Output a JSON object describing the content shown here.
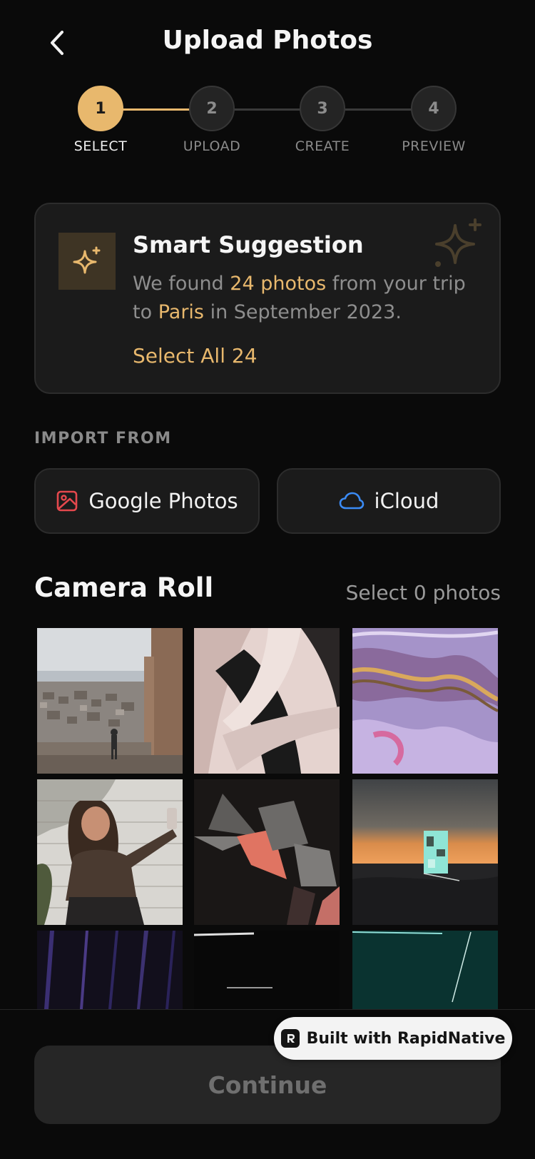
{
  "header": {
    "title": "Upload Photos"
  },
  "stepper": {
    "steps": [
      {
        "number": "1",
        "label": "SELECT"
      },
      {
        "number": "2",
        "label": "UPLOAD"
      },
      {
        "number": "3",
        "label": "CREATE"
      },
      {
        "number": "4",
        "label": "PREVIEW"
      }
    ],
    "current_step": 1
  },
  "suggestion": {
    "title": "Smart Suggestion",
    "text_1": "We found ",
    "photo_count": "24 photos",
    "text_2": " from your trip to ",
    "place": "Paris",
    "text_3": " in September 2023.",
    "select_all": "Select All 24"
  },
  "import": {
    "label": "IMPORT FROM",
    "google": "Google Photos",
    "icloud": "iCloud"
  },
  "camera_roll": {
    "title": "Camera Roll",
    "select_label": "Select 0 photos"
  },
  "footer": {
    "continue": "Continue",
    "badge": "Built with RapidNative"
  },
  "colors": {
    "accent": "#e8b86d",
    "background": "#0a0a0a",
    "card": "#1b1b1b",
    "google_icon": "#e5484d",
    "icloud_icon": "#3b8bf5"
  }
}
